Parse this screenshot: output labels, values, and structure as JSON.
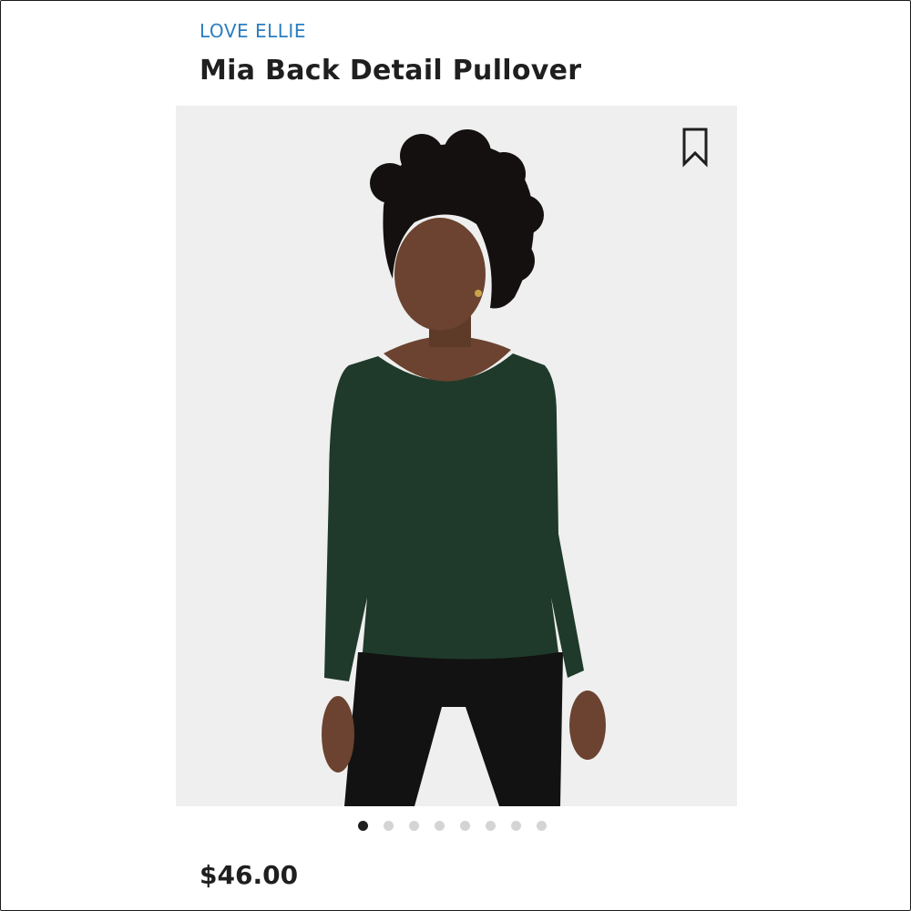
{
  "product": {
    "brand": "LOVE ELLIE",
    "name": "Mia Back Detail Pullover",
    "price": "$46.00"
  },
  "gallery": {
    "total_images": 8,
    "active_index": 0
  },
  "icons": {
    "bookmark": "bookmark-icon"
  },
  "colors": {
    "brand_text": "#2b7ec1",
    "sweater": "#1f3a2a",
    "active_dot": "#1f1f1f",
    "inactive_dot": "#d4d4d4"
  }
}
